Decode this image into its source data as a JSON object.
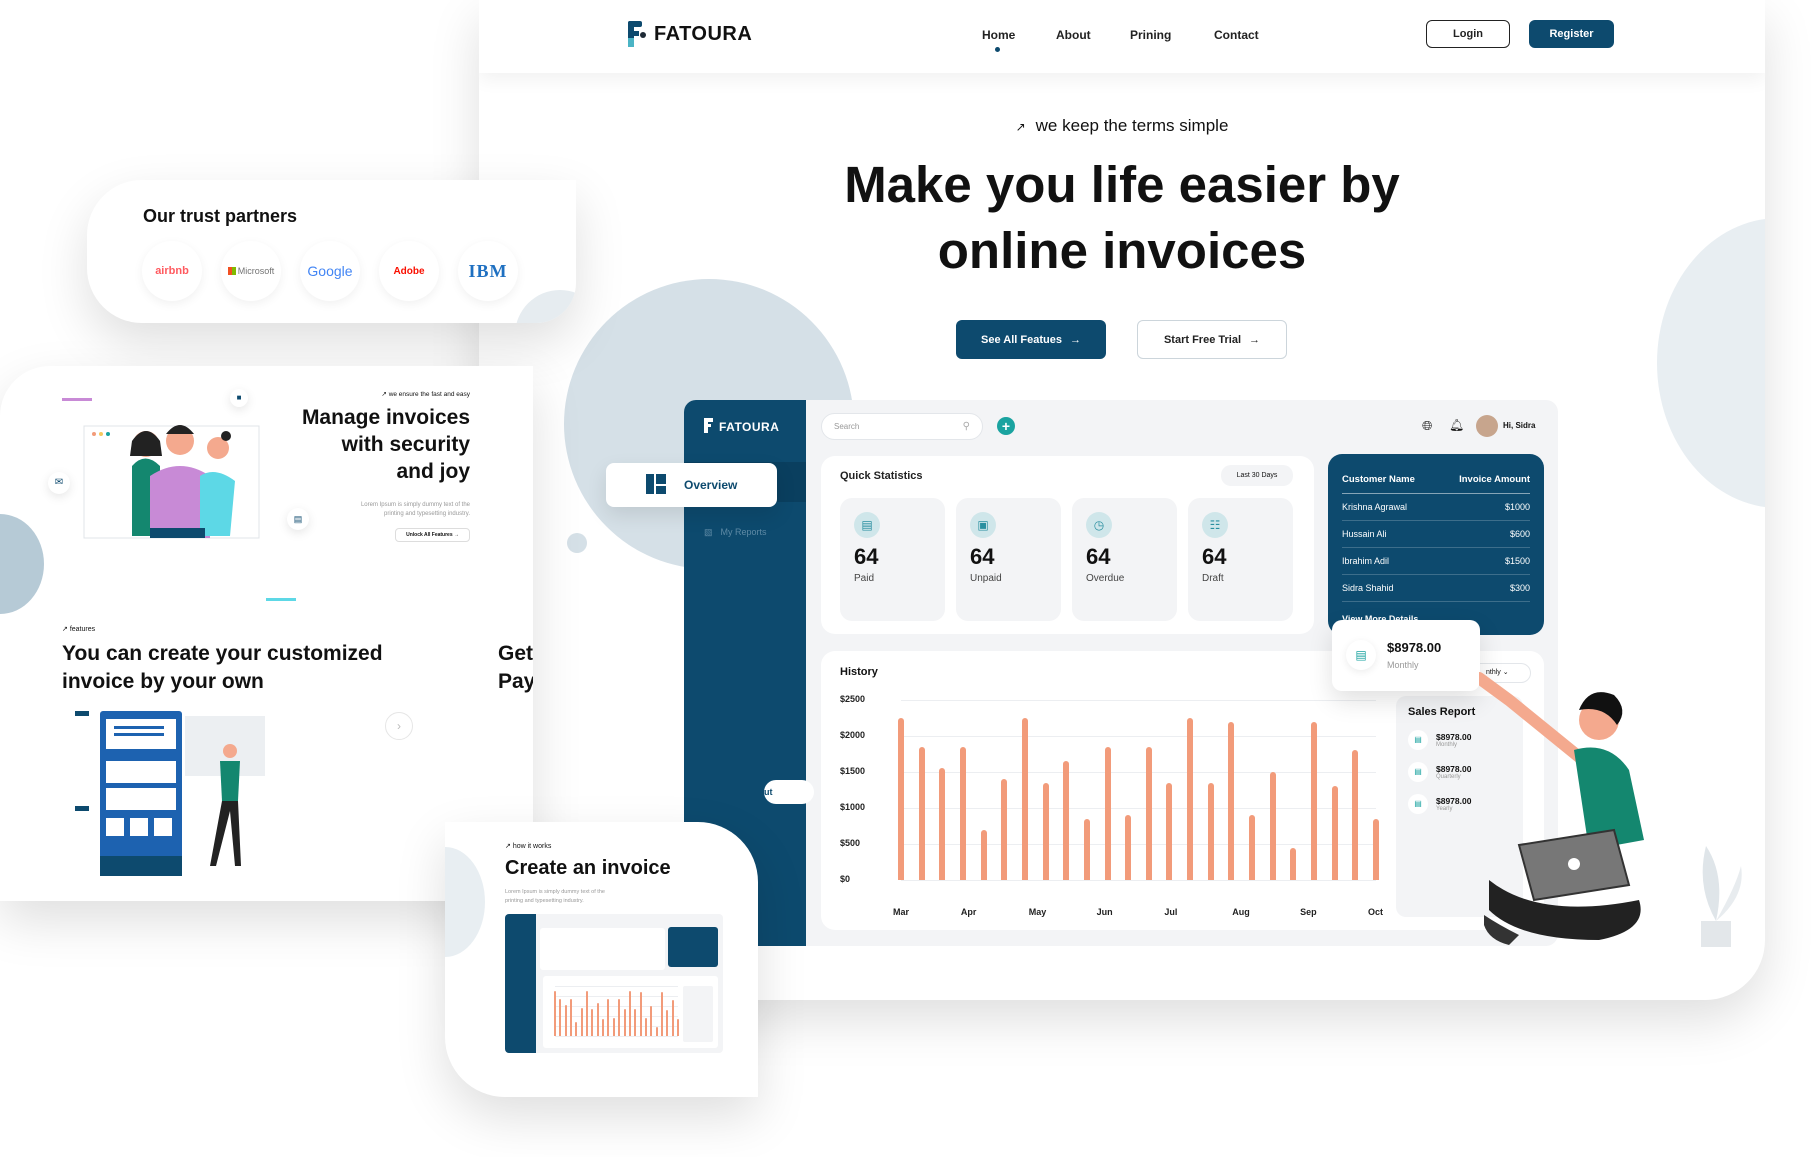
{
  "brand": {
    "name": "FATOURA",
    "primary": "#0d4a6e",
    "accent": "#f29b7a",
    "teal": "#1aa3a0"
  },
  "nav": {
    "items": [
      "Home",
      "About",
      "Prining",
      "Contact"
    ],
    "active": "Home",
    "login": "Login",
    "register": "Register"
  },
  "hero": {
    "tagline": "we keep the terms simple",
    "title_line1": "Make you life easier by",
    "title_line2": "online invoices",
    "primary_cta": "See All Featues",
    "secondary_cta": "Start Free Trial"
  },
  "dashboard": {
    "brand": "FATOURA",
    "search_placeholder": "Search",
    "greeting": "Hi, Sidra",
    "sidebar": {
      "overview": "Overview",
      "reports": "My Reports",
      "logout": "ut"
    },
    "quick_stats": {
      "title": "Quick Statistics",
      "range": "Last 30 Days",
      "tiles": [
        {
          "value": "64",
          "label": "Paid",
          "icon": "invoice-icon"
        },
        {
          "value": "64",
          "label": "Unpaid",
          "icon": "card-icon"
        },
        {
          "value": "64",
          "label": "Overdue",
          "icon": "clock-icon"
        },
        {
          "value": "64",
          "label": "Draft",
          "icon": "document-icon"
        }
      ]
    },
    "customers": {
      "headers": [
        "Customer Name",
        "Invoice Amount"
      ],
      "rows": [
        [
          "Krishna Agrawal",
          "$1000"
        ],
        [
          "Hussain Ali",
          "$600"
        ],
        [
          "Ibrahim Adil",
          "$1500"
        ],
        [
          "Sidra Shahid",
          "$300"
        ]
      ],
      "more": "View More Details"
    },
    "floating_card": {
      "amount": "$8978.00",
      "period": "Monthly"
    },
    "period_select": "nthly",
    "sales_report": {
      "title": "Sales Report",
      "items": [
        {
          "amount": "$8978.00",
          "period": "Monthly"
        },
        {
          "amount": "$8978.00",
          "period": "Quarterly"
        },
        {
          "amount": "$8978.00",
          "period": "Yearly"
        }
      ]
    }
  },
  "chart_data": {
    "type": "bar",
    "title": "History",
    "y_tick_labels": [
      "$2500",
      "$2000",
      "$1500",
      "$1000",
      "$500",
      "$0"
    ],
    "ylim": [
      0,
      2500
    ],
    "x_tick_labels": [
      "Mar",
      "Apr",
      "May",
      "Jun",
      "Jul",
      "Aug",
      "Sep",
      "Oct"
    ],
    "values": [
      2250,
      1850,
      1550,
      1850,
      700,
      1400,
      2250,
      1350,
      1650,
      850,
      1850,
      900,
      1850,
      1350,
      2250,
      1350,
      2200,
      900,
      1500,
      450,
      2200,
      1300,
      1800,
      850
    ],
    "grid": true,
    "color": "#f29b7a"
  },
  "partners": {
    "title": "Our trust partners",
    "logos": [
      "airbnb",
      "Microsoft",
      "Google",
      "Adobe",
      "IBM"
    ]
  },
  "security": {
    "tagline": "we ensure the fast and easy",
    "title_lines": [
      "Manage invoices",
      "with security",
      "and joy"
    ],
    "body_lines": [
      "Lorem Ipsum is simply dummy text of the",
      "printing and typesetting industry."
    ],
    "cta": "Unlock All Features"
  },
  "features": {
    "tagline": "features",
    "title_lines": [
      "You can create your customized",
      "invoice by your own"
    ],
    "side_lines": [
      "Get",
      "Pay"
    ]
  },
  "how": {
    "tagline": "how it works",
    "title": "Create an invoice",
    "body_lines": [
      "Lorem Ipsum is simply dummy text of the",
      "printing and typesetting industry."
    ]
  }
}
